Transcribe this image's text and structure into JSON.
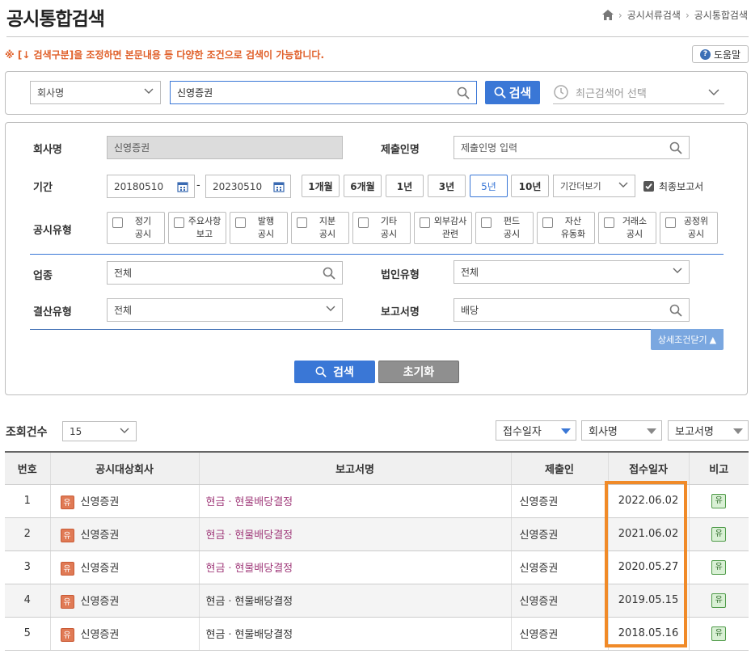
{
  "header": {
    "title": "공시통합검색",
    "breadcrumb": [
      "공시서류검색",
      "공시통합검색"
    ]
  },
  "notice": "※ [↓ 검색구분]을 조정하면 본문내용 등 다양한 조건으로 검색이 가능합니다.",
  "help_label": "도움말",
  "search": {
    "category_value": "회사명",
    "query_value": "신영증권",
    "button_label": "검색",
    "recent_placeholder": "최근검색어 선택"
  },
  "detail": {
    "company_label": "회사명",
    "company_value": "신영증권",
    "filer_label": "제출인명",
    "filer_placeholder": "제출인명 입력",
    "period_label": "기간",
    "date_start": "20180510",
    "date_sep": "-",
    "date_end": "20230510",
    "period_buttons": [
      "1개월",
      "6개월",
      "1년",
      "3년",
      "5년",
      "10년"
    ],
    "period_more": "기간더보기",
    "final_report_label": "최종보고서",
    "disclosure_type_label": "공시유형",
    "disclosure_types": [
      {
        "l1": "정기",
        "l2": "공시"
      },
      {
        "l1": "주요사항",
        "l2": "보고"
      },
      {
        "l1": "발행",
        "l2": "공시"
      },
      {
        "l1": "지분",
        "l2": "공시"
      },
      {
        "l1": "기타",
        "l2": "공시"
      },
      {
        "l1": "외부감사",
        "l2": "관련"
      },
      {
        "l1": "펀드",
        "l2": "공시"
      },
      {
        "l1": "자산",
        "l2": "유동화"
      },
      {
        "l1": "거래소",
        "l2": "공시"
      },
      {
        "l1": "공정위",
        "l2": "공시"
      }
    ],
    "industry_label": "업종",
    "industry_value": "전체",
    "corp_type_label": "법인유형",
    "corp_type_value": "전체",
    "settlement_label": "결산유형",
    "settlement_value": "전체",
    "report_name_label": "보고서명",
    "report_name_value": "배당",
    "close_detail_label": "상세조건닫기",
    "search_button": "검색",
    "reset_button": "초기화"
  },
  "results": {
    "count_label": "조회건수",
    "page_size": "15",
    "sort_options": [
      "접수일자",
      "회사명",
      "보고서명"
    ],
    "columns": [
      "번호",
      "공시대상회사",
      "보고서명",
      "제출인",
      "접수일자",
      "비고"
    ],
    "company_badge": "유",
    "note_badge": "유",
    "rows": [
      {
        "no": "1",
        "company": "신영증권",
        "report": "현금ㆍ현물배당결정",
        "filer": "신영증권",
        "date": "2022.06.02",
        "link": true
      },
      {
        "no": "2",
        "company": "신영증권",
        "report": "현금ㆍ현물배당결정",
        "filer": "신영증권",
        "date": "2021.06.02",
        "link": true
      },
      {
        "no": "3",
        "company": "신영증권",
        "report": "현금ㆍ현물배당결정",
        "filer": "신영증권",
        "date": "2020.05.27",
        "link": true
      },
      {
        "no": "4",
        "company": "신영증권",
        "report": "현금ㆍ현물배당결정",
        "filer": "신영증권",
        "date": "2019.05.15",
        "link": false
      },
      {
        "no": "5",
        "company": "신영증권",
        "report": "현금ㆍ현물배당결정",
        "filer": "신영증권",
        "date": "2018.05.16",
        "link": false
      }
    ]
  },
  "colors": {
    "accent_blue": "#3a77d6",
    "notice_orange": "#e0602a",
    "highlight_orange": "#f08a28",
    "report_link": "#a03a7a"
  }
}
